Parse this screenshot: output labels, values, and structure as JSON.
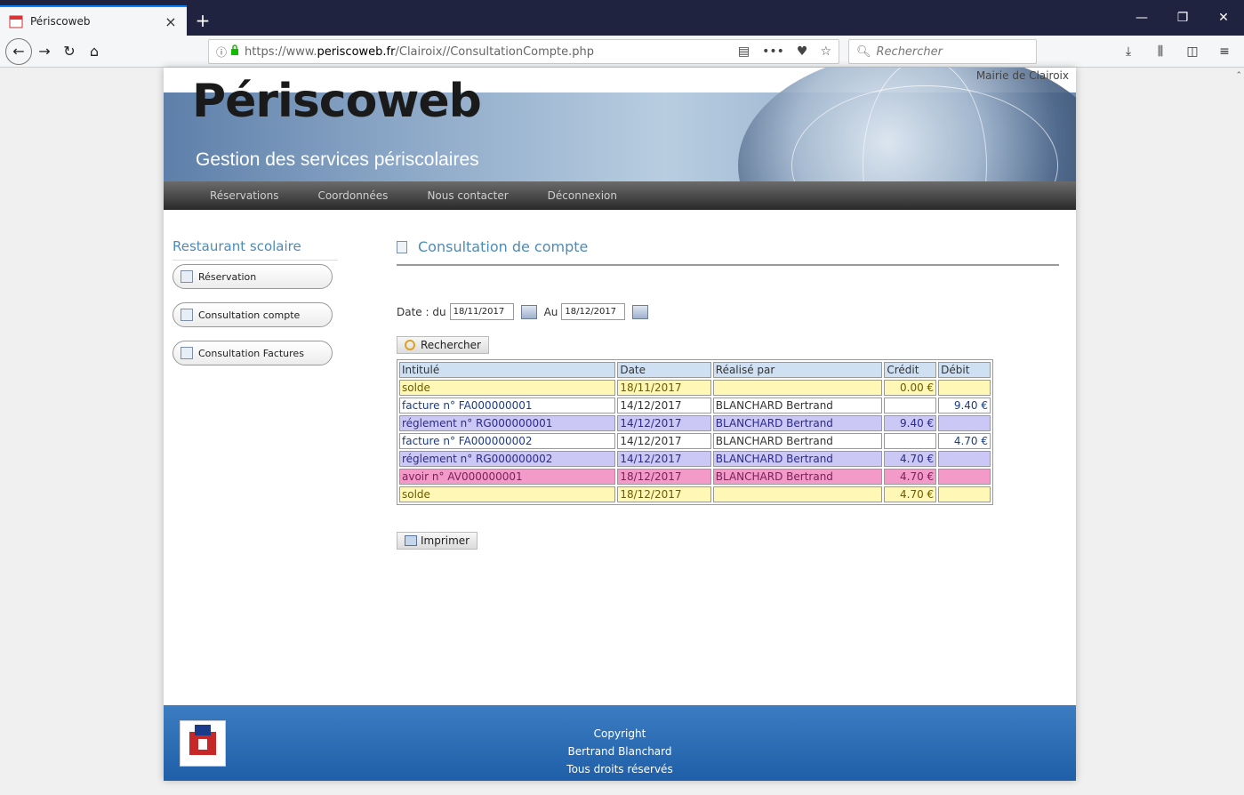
{
  "browser": {
    "tab_title": "Périscoweb",
    "url_scheme": "https://www.",
    "url_domain": "periscoweb.fr",
    "url_path": "/Clairoix//ConsultationCompte.php",
    "search_placeholder": "Rechercher"
  },
  "header": {
    "brand": "Périscoweb",
    "subtitle": "Gestion des services périscolaires",
    "mairie": "Mairie de Clairoix"
  },
  "nav": {
    "items": [
      "Réservations",
      "Coordonnées",
      "Nous contacter",
      "Déconnexion"
    ]
  },
  "sidebar": {
    "title": "Restaurant scolaire",
    "items": [
      "Réservation",
      "Consultation compte",
      "Consultation Factures"
    ]
  },
  "content": {
    "title": "Consultation de compte",
    "date_label": "Date : du",
    "date_from": "18/11/2017",
    "date_to_label": "Au",
    "date_to": "18/12/2017",
    "search_button": "Rechercher",
    "print_button": "Imprimer",
    "table": {
      "headers": [
        "Intitulé",
        "Date",
        "Réalisé par",
        "Crédit",
        "Débit"
      ],
      "rows": [
        {
          "type": "solde",
          "intitule": "solde",
          "date": "18/11/2017",
          "par": "",
          "credit": "0.00 €",
          "debit": ""
        },
        {
          "type": "fact",
          "intitule": "facture n° FA000000001",
          "date": "14/12/2017",
          "par": "BLANCHARD Bertrand",
          "credit": "",
          "debit": "9.40 €"
        },
        {
          "type": "regl",
          "intitule": "réglement n° RG000000001",
          "date": "14/12/2017",
          "par": "BLANCHARD Bertrand",
          "credit": "9.40 €",
          "debit": ""
        },
        {
          "type": "fact",
          "intitule": "facture n° FA000000002",
          "date": "14/12/2017",
          "par": "BLANCHARD Bertrand",
          "credit": "",
          "debit": "4.70 €"
        },
        {
          "type": "regl",
          "intitule": "réglement n° RG000000002",
          "date": "14/12/2017",
          "par": "BLANCHARD Bertrand",
          "credit": "4.70 €",
          "debit": ""
        },
        {
          "type": "avoir",
          "intitule": "avoir n° AV000000001",
          "date": "18/12/2017",
          "par": "BLANCHARD Bertrand",
          "credit": "4.70 €",
          "debit": ""
        },
        {
          "type": "solde",
          "intitule": "solde",
          "date": "18/12/2017",
          "par": "",
          "credit": "4.70 €",
          "debit": ""
        }
      ]
    }
  },
  "footer": {
    "line1": "Copyright",
    "line2": "Bertrand Blanchard",
    "line3": "Tous droits réservés"
  },
  "colors": {
    "accent_blue": "#4d8bb8",
    "solde_row": "#fff7b5",
    "reglement_row": "#ccc8f6",
    "avoir_row": "#f49ac8",
    "footer_blue": "#2f6fb6"
  }
}
